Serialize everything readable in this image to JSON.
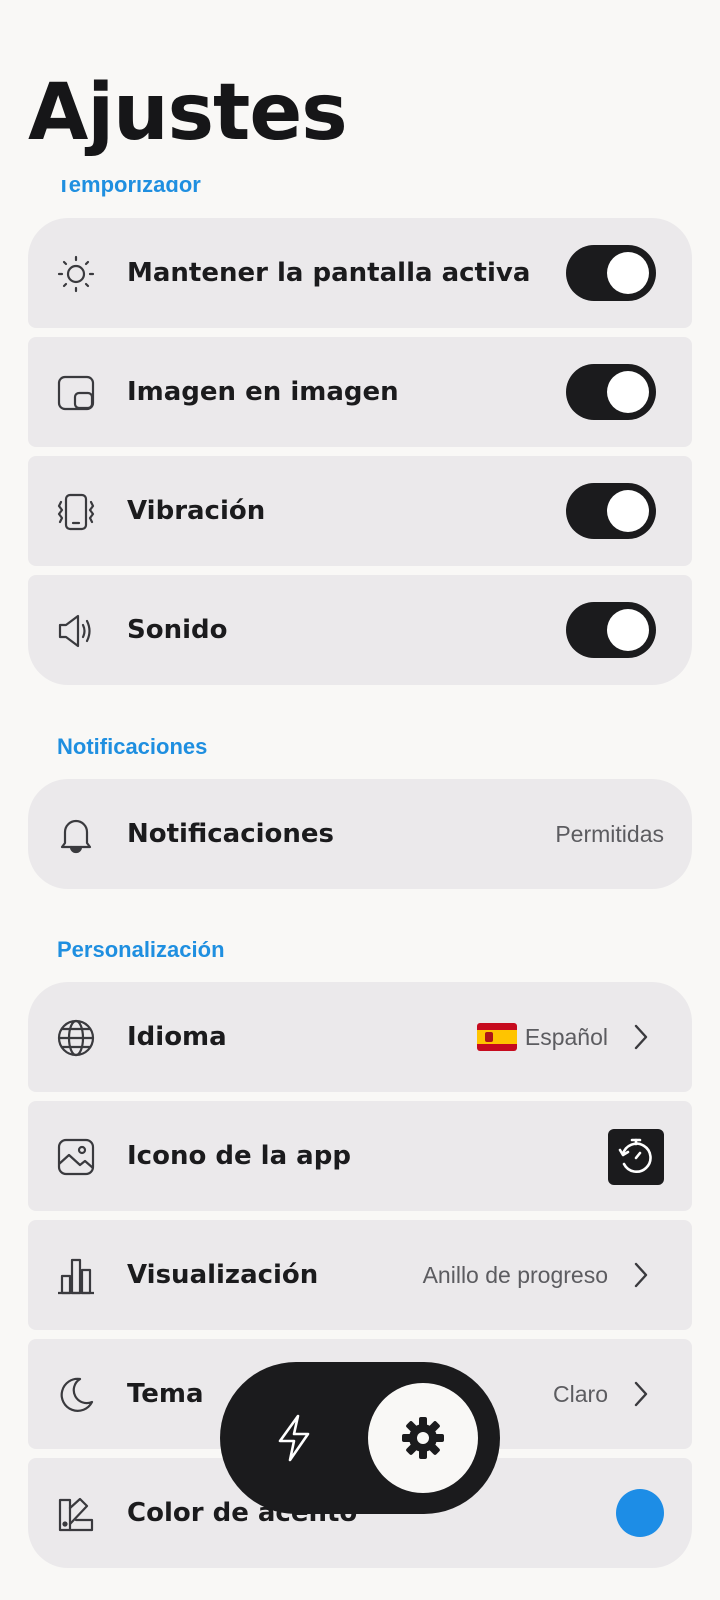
{
  "header": {
    "title": "Ajustes"
  },
  "sections": {
    "timer": {
      "label": "Temporizador"
    },
    "notifications": {
      "label": "Notificaciones"
    },
    "personalization": {
      "label": "Personalización"
    }
  },
  "timer_items": [
    {
      "label": "Mantener la pantalla activa",
      "icon": "brightness-icon",
      "enabled": true
    },
    {
      "label": "Imagen en imagen",
      "icon": "picture-in-picture-icon",
      "enabled": true
    },
    {
      "label": "Vibración",
      "icon": "vibration-icon",
      "enabled": true
    },
    {
      "label": "Sonido",
      "icon": "speaker-icon",
      "enabled": true
    }
  ],
  "notification_item": {
    "label": "Notificaciones",
    "icon": "bell-icon",
    "value": "Permitidas"
  },
  "personalization_items": {
    "language": {
      "label": "Idioma",
      "icon": "globe-icon",
      "value": "Español",
      "flag": "spain-flag-icon"
    },
    "app_icon": {
      "label": "Icono de la app",
      "icon": "image-icon",
      "preview": "stopwatch-icon"
    },
    "display": {
      "label": "Visualización",
      "icon": "bar-chart-icon",
      "value": "Anillo de progreso"
    },
    "theme": {
      "label": "Tema",
      "icon": "moon-icon",
      "value": "Claro"
    },
    "accent": {
      "label": "Color de acento",
      "icon": "palette-icon",
      "color": "#1d8de6"
    }
  },
  "bottom_nav": {
    "items": [
      {
        "icon": "bolt-icon",
        "active": false
      },
      {
        "icon": "gear-icon",
        "active": true
      }
    ]
  },
  "colors": {
    "accent": "#1f8fe0",
    "card": "#ebe9eb",
    "background": "#f9f8f6",
    "toggle_on": "#1b1b1d"
  }
}
